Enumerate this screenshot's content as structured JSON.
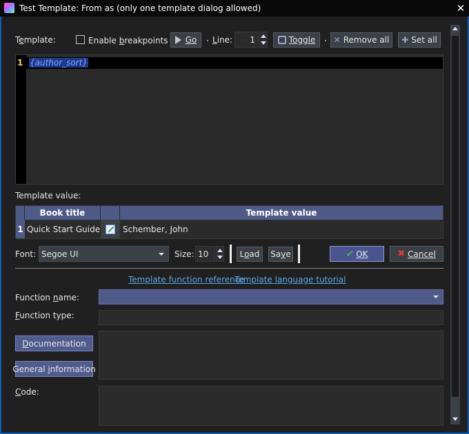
{
  "window": {
    "title": "Test Template: From as (only one template dialog allowed)",
    "close_glyph": "✕"
  },
  "toolbar": {
    "template_label": "Template:",
    "enable_breakpoints_label": "Enable breakpoints",
    "enable_breakpoints_checked": false,
    "go_label": "Go",
    "line_label": "Line:",
    "line_value": "1",
    "toggle_label": "Toggle",
    "remove_all_label": "Remove all",
    "set_all_label": "Set all"
  },
  "editor": {
    "line_number": "1",
    "code": "{author_sort}"
  },
  "template_value": {
    "label": "Template value:",
    "columns": [
      "Book title",
      "Template value"
    ],
    "rows": [
      {
        "row_number": "1",
        "book_title": "Quick Start Guide",
        "value": "Schember, John"
      }
    ]
  },
  "font_row": {
    "font_label": "Font:",
    "font_value": "Segoe UI",
    "size_label": "Size:",
    "size_value": "10",
    "load_label": "Load",
    "save_label": "Save",
    "ok_label": "OK",
    "cancel_label": "Cancel"
  },
  "links": {
    "function_reference": "Template function reference",
    "language_tutorial": "Template language tutorial"
  },
  "function_section": {
    "function_name_label": "Function name:",
    "function_name_value": "",
    "function_type_label": "Function type:",
    "function_type_value": "",
    "documentation_label": "Documentation",
    "general_information_label": "General information",
    "code_label": "Code:"
  },
  "colors": {
    "accent_blue": "#0d5fb8",
    "header_blue": "#505a88",
    "line_number_yellow": "#ffd54a",
    "link_blue": "#5ca7e8",
    "ok_check_green": "#4caf50",
    "cancel_x_red": "#e53935"
  }
}
